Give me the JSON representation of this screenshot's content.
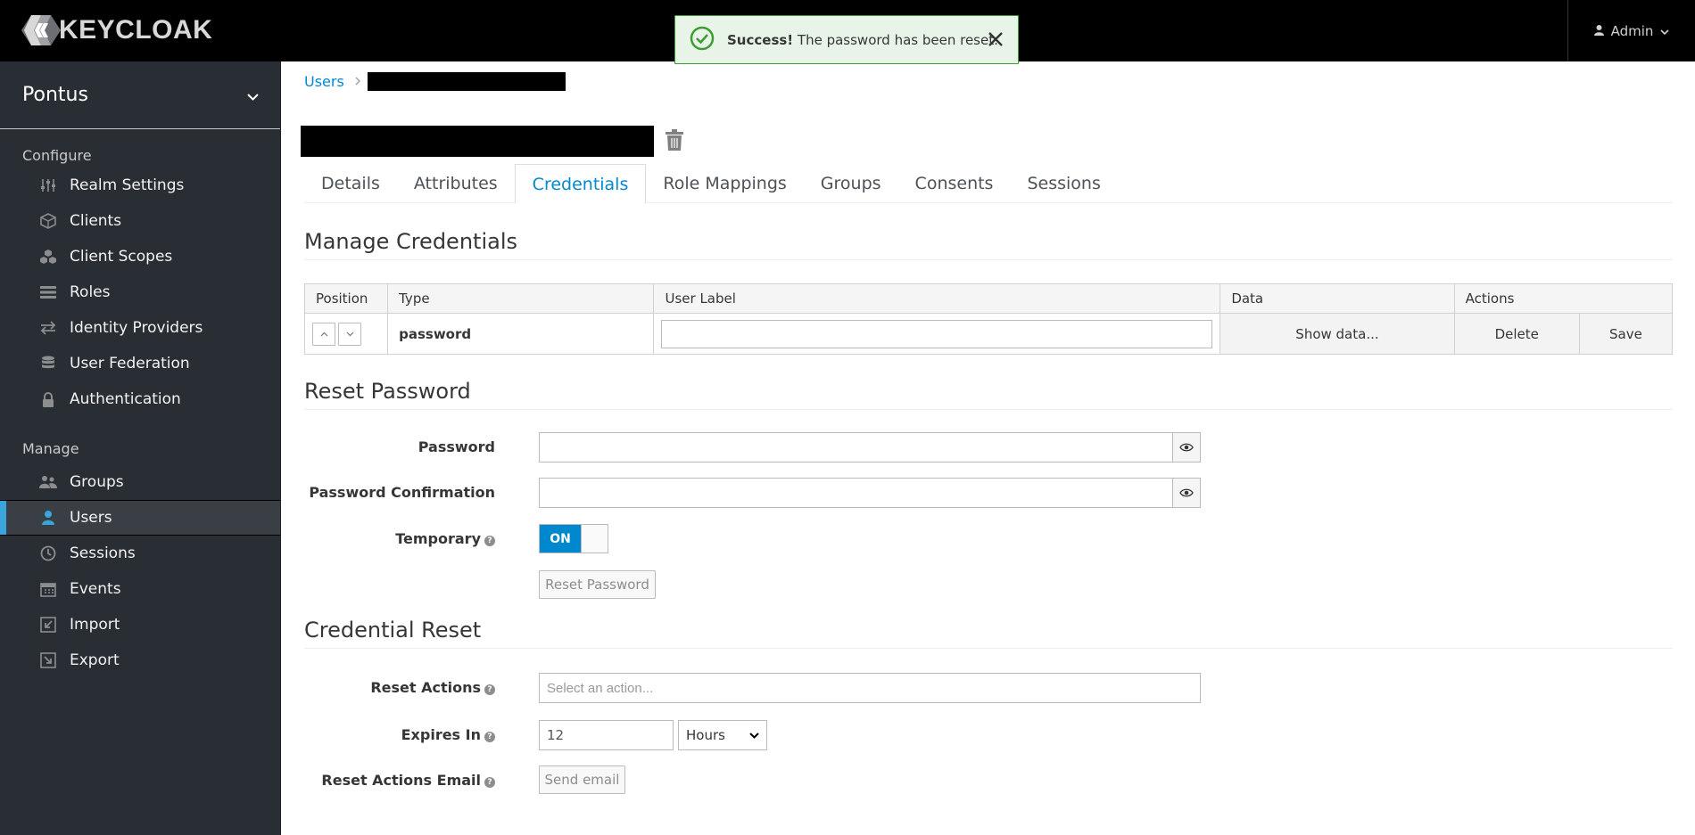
{
  "header": {
    "logo_text": "KEYCLOAK",
    "user_menu": "Admin"
  },
  "toast": {
    "title": "Success!",
    "message": "The password has been reset."
  },
  "sidebar": {
    "realm": "Pontus",
    "configure_title": "Configure",
    "configure_items": [
      {
        "label": "Realm Settings",
        "icon": "sliders-icon"
      },
      {
        "label": "Clients",
        "icon": "cube-icon"
      },
      {
        "label": "Client Scopes",
        "icon": "cubes-icon"
      },
      {
        "label": "Roles",
        "icon": "list-icon"
      },
      {
        "label": "Identity Providers",
        "icon": "exchange-icon"
      },
      {
        "label": "User Federation",
        "icon": "database-icon"
      },
      {
        "label": "Authentication",
        "icon": "lock-icon"
      }
    ],
    "manage_title": "Manage",
    "manage_items": [
      {
        "label": "Groups",
        "icon": "users-icon"
      },
      {
        "label": "Users",
        "icon": "user-icon",
        "active": true
      },
      {
        "label": "Sessions",
        "icon": "clock-icon"
      },
      {
        "label": "Events",
        "icon": "calendar-icon"
      },
      {
        "label": "Import",
        "icon": "import-icon"
      },
      {
        "label": "Export",
        "icon": "export-icon"
      }
    ]
  },
  "breadcrumb": {
    "users": "Users"
  },
  "tabs": [
    "Details",
    "Attributes",
    "Credentials",
    "Role Mappings",
    "Groups",
    "Consents",
    "Sessions"
  ],
  "active_tab": "Credentials",
  "manage_credentials": {
    "title": "Manage Credentials",
    "columns": [
      "Position",
      "Type",
      "User Label",
      "Data",
      "Actions"
    ],
    "row": {
      "type": "password",
      "user_label": "",
      "show_data": "Show data...",
      "delete": "Delete",
      "save": "Save"
    }
  },
  "reset_password": {
    "title": "Reset Password",
    "password_label": "Password",
    "confirm_label": "Password Confirmation",
    "temporary_label": "Temporary",
    "temporary_value": "ON",
    "button": "Reset Password"
  },
  "credential_reset": {
    "title": "Credential Reset",
    "actions_label": "Reset Actions",
    "actions_placeholder": "Select an action...",
    "expires_label": "Expires In",
    "expires_value": "12",
    "expires_unit": "Hours",
    "email_label": "Reset Actions Email",
    "email_button": "Send email"
  },
  "colors": {
    "accent": "#0088ce",
    "sidebar_bg": "#292e34",
    "success_bg": "#e9f4e9",
    "success_border": "#3f9c35"
  }
}
